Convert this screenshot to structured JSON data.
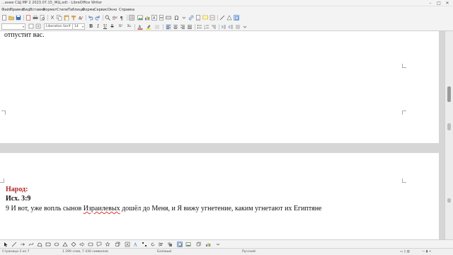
{
  "window": {
    "title": "...ание СЩ МР 2 2023.07.15_ЖЦ.odt - LibreOffice Writer"
  },
  "menu": [
    "Файл",
    "Правка",
    "Вид",
    "Вставка",
    "Формат",
    "Стили",
    "Таблица",
    "Форма",
    "Сервис",
    "Окно",
    "Справка"
  ],
  "toolbar": {
    "font_name": "Liberation Serif",
    "font_size": "14"
  },
  "document": {
    "page1_line": "отпустит вас.",
    "heading": "Народ:",
    "reference": "Исх. 3:9",
    "verse_before": "9 И вот, уже вопль сынов ",
    "verse_misspelled": "Израилевых",
    "verse_after": " дошёл до Меня, и Я вижу угнетение, каким угнетают их Египтяне"
  },
  "statusbar": {
    "page": "Страница 2 из 7",
    "words": "1 290 слов, 7 430 символов",
    "style": "Базовый",
    "language": "Русский"
  },
  "colors": {
    "heading_red": "#b3262a",
    "chrome": "#f3f3f3",
    "workspace": "#d6d6d6"
  },
  "icons": {
    "toolbar1": [
      "new-document-icon",
      "open-icon",
      "save-icon",
      "export-pdf-icon",
      "print-icon",
      "print-preview-icon",
      "cut-icon",
      "copy-icon",
      "paste-icon",
      "clone-formatting-icon",
      "clear-formatting-icon",
      "undo-icon",
      "redo-icon",
      "find-replace-icon",
      "spelling-icon",
      "formatting-marks-icon",
      "insert-table-icon",
      "insert-image-icon",
      "insert-chart-icon",
      "insert-textbox-icon",
      "page-break-icon",
      "insert-field-icon",
      "special-character-icon",
      "hyperlink-icon",
      "footnote-icon",
      "comment-icon",
      "track-changes-icon",
      "line-icon",
      "shapes-icon",
      "draw-functions-icon"
    ],
    "toolbar2_fmt": [
      "B",
      "I",
      "U",
      "S",
      "X²",
      "X₂"
    ]
  }
}
